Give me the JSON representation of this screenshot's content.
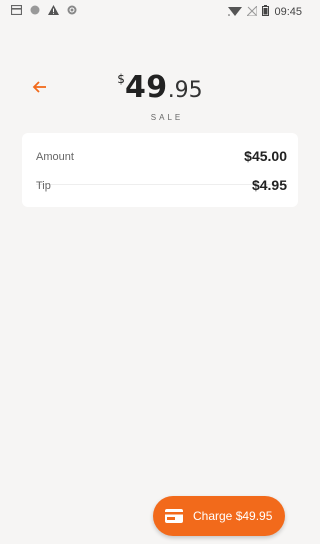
{
  "status_bar": {
    "time": "09:45",
    "left_icons": [
      "sim-card-icon",
      "circle-icon",
      "warning-icon",
      "sync-icon"
    ],
    "right_icons": [
      "wifi-icon",
      "no-signal-icon",
      "battery-icon"
    ]
  },
  "header": {
    "back_icon": "arrow-left-icon",
    "total_currency": "$",
    "total_whole": "49",
    "total_cents": ".95",
    "transaction_type": "SALE"
  },
  "summary": {
    "rows": [
      {
        "label": "Amount",
        "value": "$45.00"
      },
      {
        "label": "Tip",
        "value": "$4.95"
      }
    ]
  },
  "charge_button": {
    "icon": "credit-card-icon",
    "label": "Charge $49.95"
  },
  "colors": {
    "accent": "#f26a1b",
    "background": "#f6f5f4",
    "card": "#ffffff"
  }
}
